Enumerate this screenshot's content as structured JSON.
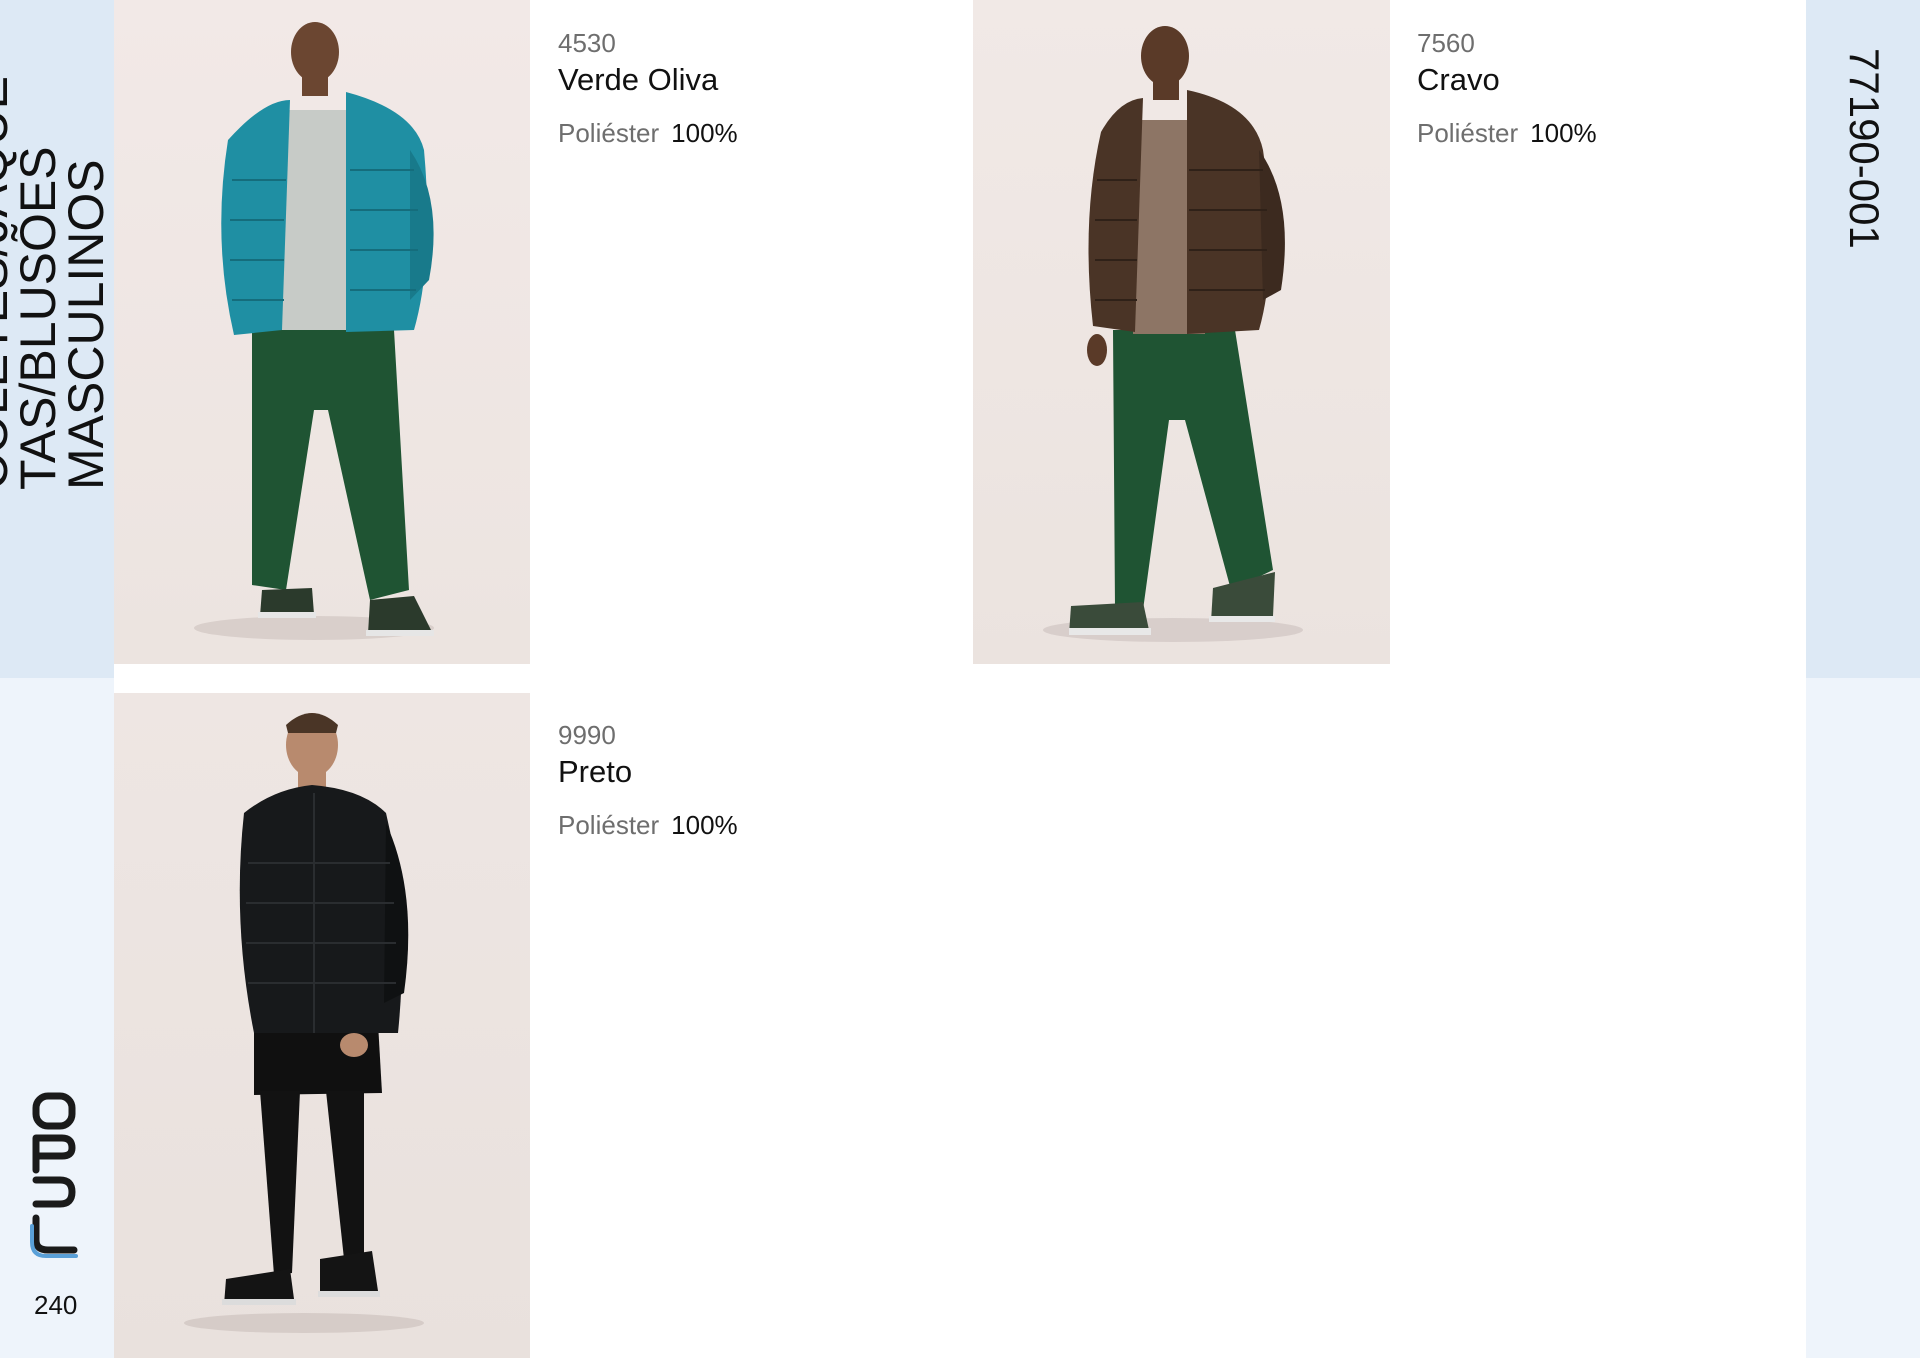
{
  "category": {
    "text": "COLETES/JAQUE-\nTAS/BLUSÕES\nMASCULINOS"
  },
  "reference_code": "77190-001",
  "brand": {
    "logo_text": "LUPO",
    "accent_color": "#5aa0d8"
  },
  "page_number": "240",
  "products": [
    {
      "color_code": "4530",
      "color_name": "Verde Oliva",
      "material": "Poliéster",
      "percentage": "100%",
      "jacket_color": "#1f8fa3",
      "pants_color": "#1f5433"
    },
    {
      "color_code": "7560",
      "color_name": "Cravo",
      "material": "Poliéster",
      "percentage": "100%",
      "jacket_color": "#4a3426",
      "pants_color": "#1f5433"
    },
    {
      "color_code": "9990",
      "color_name": "Preto",
      "material": "Poliéster",
      "percentage": "100%",
      "jacket_color": "#17191b",
      "pants_color": "#121212"
    }
  ]
}
